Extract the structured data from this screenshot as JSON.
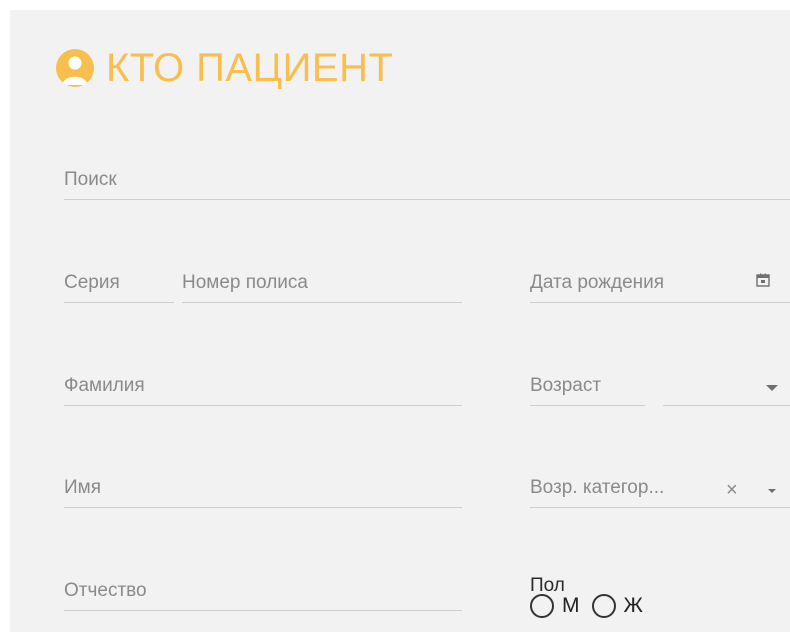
{
  "header": {
    "title": "КТО ПАЦИЕНТ",
    "icon": "person-avatar-icon",
    "accent_color": "#f8bf4f"
  },
  "fields": {
    "search": {
      "label": "Поиск"
    },
    "series": {
      "label": "Серия"
    },
    "policy_number": {
      "label": "Номер полиса"
    },
    "birth_date": {
      "label": "Дата рождения",
      "icon": "calendar-icon"
    },
    "last_name": {
      "label": "Фамилия"
    },
    "age": {
      "label": "Возраст",
      "icon": "dropdown-caret-icon"
    },
    "first_name": {
      "label": "Имя"
    },
    "age_category": {
      "label": "Возр. категор...",
      "clear_icon": "close-icon",
      "icon": "dropdown-caret-icon"
    },
    "patronymic": {
      "label": "Отчество"
    }
  },
  "gender": {
    "label": "Пол",
    "options": [
      {
        "label": "М",
        "selected": false
      },
      {
        "label": "Ж",
        "selected": false
      }
    ]
  }
}
